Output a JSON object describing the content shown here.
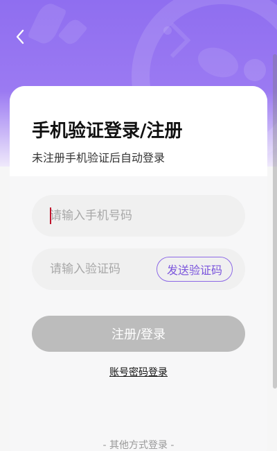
{
  "header": {
    "back_icon": "chevron-left-icon"
  },
  "form": {
    "title": "手机验证登录/注册",
    "subtitle": "未注册手机验证后自动登录",
    "phone_placeholder": "请输入手机号码",
    "phone_value": "",
    "code_placeholder": "请输入验证码",
    "code_value": "",
    "send_code_label": "发送验证码",
    "submit_label": "注册/登录",
    "password_login_label": "账号密码登录",
    "other_login_label": "- 其他方式登录 -"
  },
  "colors": {
    "accent": "#8c68e6",
    "header": "#9677f1",
    "submit_disabled": "#bcbcbc"
  }
}
